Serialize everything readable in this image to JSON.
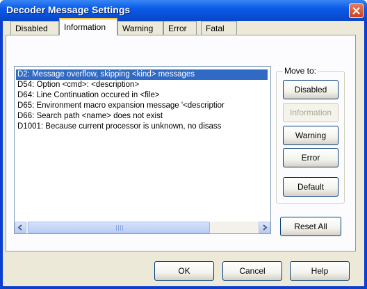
{
  "window": {
    "title": "Decoder Message Settings",
    "close_label": "close"
  },
  "tabs": [
    {
      "label": "Disabled",
      "active": false
    },
    {
      "label": "Information",
      "active": true
    },
    {
      "label": "Warning",
      "active": false
    },
    {
      "label": "Error",
      "active": false
    },
    {
      "label": "Fatal",
      "active": false
    }
  ],
  "messages": [
    {
      "text": "D2: Message overflow, skipping <kind> messages",
      "selected": true
    },
    {
      "text": "D54: Option <cmd>: <description>",
      "selected": false
    },
    {
      "text": "D64: Line Continuation occured in <file>",
      "selected": false
    },
    {
      "text": "D65: Environment macro expansion message '<descriptior",
      "selected": false
    },
    {
      "text": "D66: Search path <name> does not exist",
      "selected": false
    },
    {
      "text": "D1001: Because current processor is unknown, no disass",
      "selected": false
    }
  ],
  "move_to": {
    "label": "Move to:",
    "buttons": [
      {
        "label": "Disabled",
        "enabled": true
      },
      {
        "label": "Information",
        "enabled": false
      },
      {
        "label": "Warning",
        "enabled": true
      },
      {
        "label": "Error",
        "enabled": true
      }
    ],
    "default_label": "Default"
  },
  "reset_all_label": "Reset All",
  "footer": {
    "ok_label": "OK",
    "cancel_label": "Cancel",
    "help_label": "Help"
  },
  "colors": {
    "selection": "#316ac5",
    "title_bar": "#0a5be8",
    "dialog_bg": "#ece9d8"
  }
}
